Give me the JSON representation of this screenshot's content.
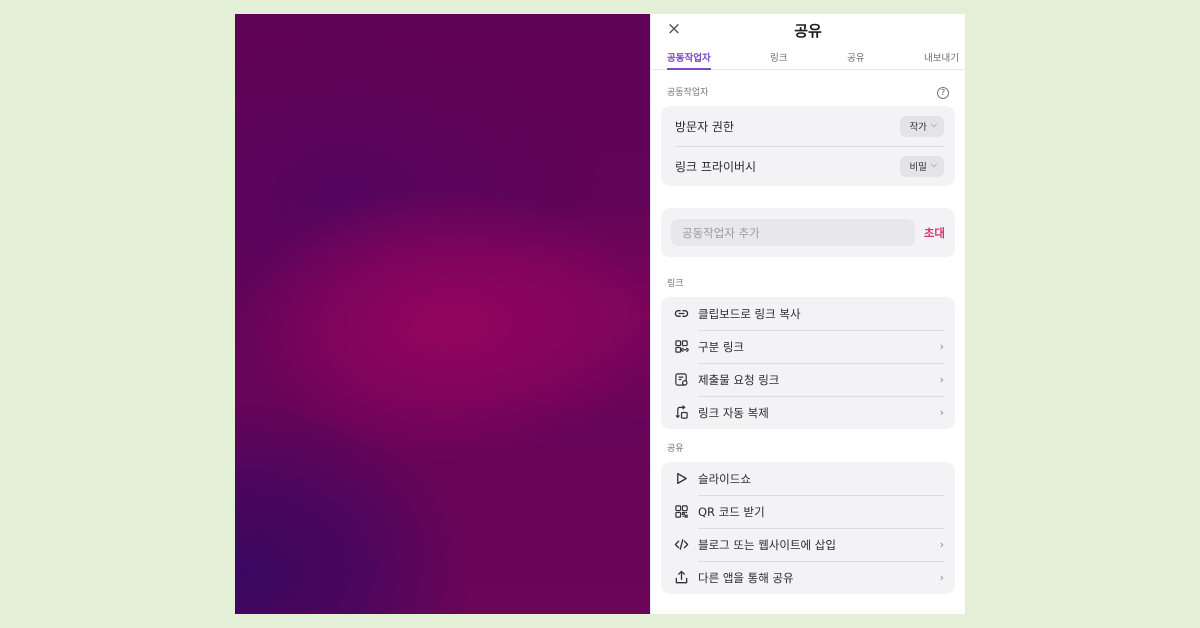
{
  "panel": {
    "title": "공유",
    "close_icon": "×"
  },
  "tabs": [
    {
      "label": "공동작업자",
      "active": true
    },
    {
      "label": "링크",
      "active": false
    },
    {
      "label": "공유",
      "active": false
    },
    {
      "label": "내보내기",
      "active": false
    }
  ],
  "collaborators": {
    "section_label": "공동작업자",
    "help_icon": "?",
    "visitor_permission": {
      "label": "방문자 권한",
      "value": "작가"
    },
    "link_privacy": {
      "label": "링크 프라이버시",
      "value": "비밀"
    },
    "invite": {
      "placeholder": "공동작업자 추가",
      "button": "초대"
    }
  },
  "links": {
    "section_label": "링크",
    "items": [
      {
        "label": "클립보드로 링크 복사",
        "icon": "link-icon",
        "chevron": false
      },
      {
        "label": "구분 링크",
        "icon": "grid-link-icon",
        "chevron": true
      },
      {
        "label": "제출물 요청 링크",
        "icon": "submission-icon",
        "chevron": true
      },
      {
        "label": "링크 자동 복제",
        "icon": "auto-duplicate-icon",
        "chevron": true
      }
    ]
  },
  "share": {
    "section_label": "공유",
    "items": [
      {
        "label": "슬라이드쇼",
        "icon": "play-icon",
        "chevron": false
      },
      {
        "label": "QR 코드 받기",
        "icon": "qr-code-icon",
        "chevron": false
      },
      {
        "label": "블로그 또는 웹사이트에 삽입",
        "icon": "code-icon",
        "chevron": true
      },
      {
        "label": "다른 앱을 통해 공유",
        "icon": "share-upload-icon",
        "chevron": true
      }
    ]
  },
  "glyphs": {
    "chevron_down": "⌵",
    "chevron_right": "›"
  },
  "colors": {
    "accent": "#7b4bc9",
    "invite": "#d9366c",
    "page_background": "#e4efd7",
    "canvas_base": "#640459"
  }
}
